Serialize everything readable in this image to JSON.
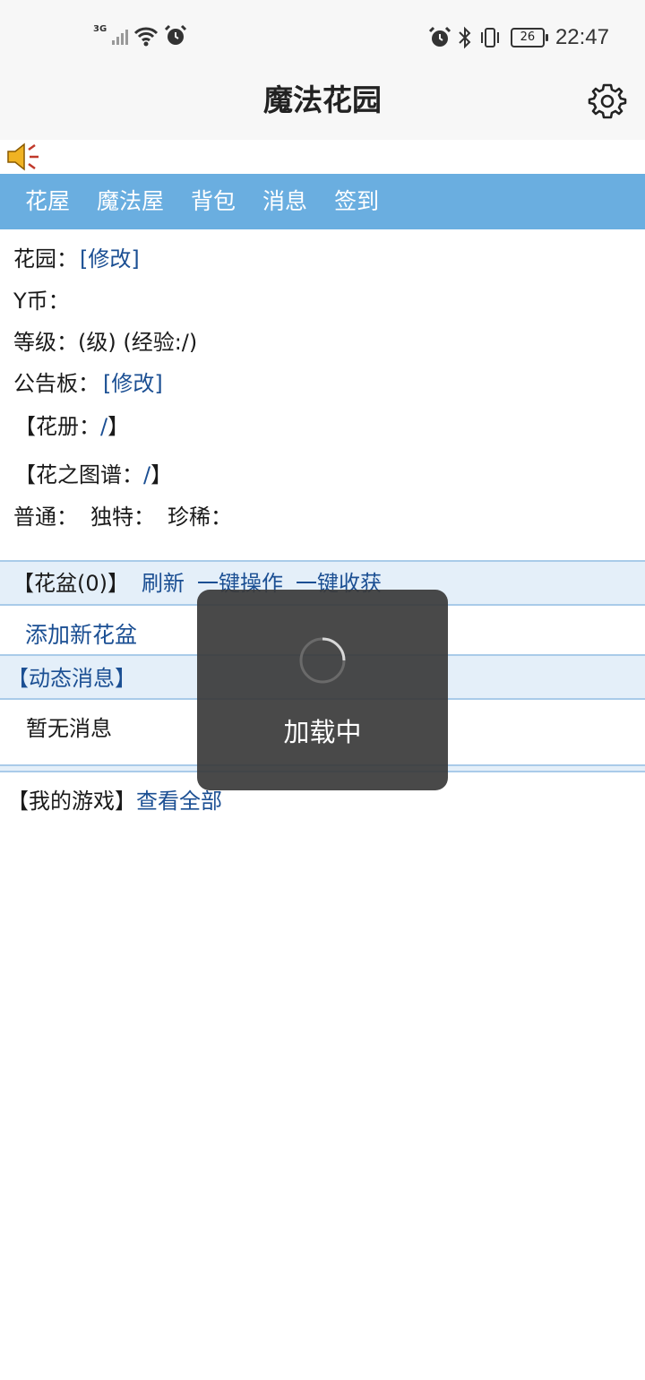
{
  "status_bar": {
    "network_type": "3G",
    "battery_level": "26",
    "time": "22:47",
    "icons": [
      "signal-icon",
      "wifi-icon",
      "alarm-icon",
      "bluetooth-icon",
      "vibrate-icon",
      "battery-icon"
    ]
  },
  "header": {
    "title": "魔法花园",
    "settings_icon": "gear-icon"
  },
  "sound_icon": "speaker-icon",
  "nav": {
    "items": [
      {
        "label": "花屋"
      },
      {
        "label": "魔法屋"
      },
      {
        "label": "背包"
      },
      {
        "label": "消息"
      },
      {
        "label": "签到"
      }
    ]
  },
  "info": {
    "garden_label": "花园：",
    "garden_edit": "[修改]",
    "coins_label": "Y币：",
    "level_text": "等级：(级) (经验:/)",
    "board_label": "公告板：",
    "board_edit": "[修改]",
    "flower_book_open": "【花册：",
    "flower_book_value": "/",
    "flower_book_close": "】",
    "atlas_open": "【花之图谱：",
    "atlas_value": "/",
    "atlas_close": "】",
    "rarity_normal": "普通：",
    "rarity_unique": "独特：",
    "rarity_rare": "珍稀："
  },
  "pots": {
    "title": "【花盆(0)】",
    "refresh": "刷新",
    "one_click_operate": "一键操作",
    "one_click_harvest": "一键收获",
    "add_pot": "添加新花盆"
  },
  "activity": {
    "title": "【动态消息】",
    "empty_text": "暂无消息"
  },
  "my_games": {
    "title": "【我的游戏】",
    "view_all": "查看全部"
  },
  "loading_toast": {
    "text": "加载中"
  },
  "colors": {
    "nav_bar": "#6aaee0",
    "link": "#1b4f93",
    "section_bg": "#e4eff9",
    "section_border": "#a9cbe9",
    "toast_bg": "#3a3a3a"
  }
}
